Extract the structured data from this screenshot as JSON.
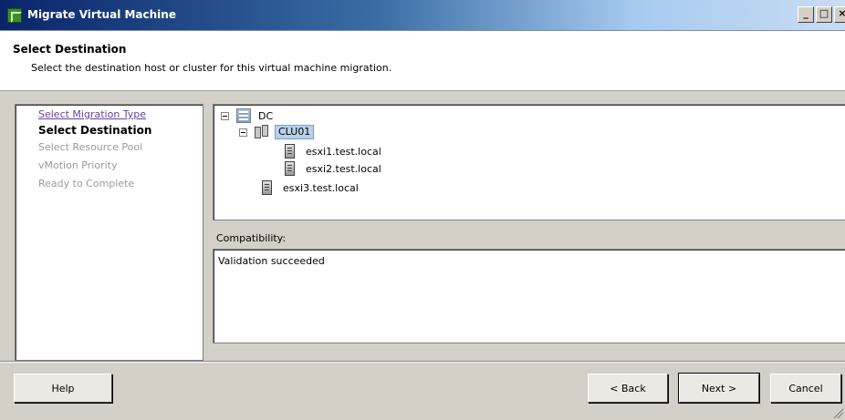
{
  "window": {
    "title": "Migrate Virtual Machine",
    "controls": [
      "_",
      "□",
      "×"
    ]
  },
  "header": {
    "title": "Select Destination",
    "subtitle": "Select the destination host or cluster for this virtual machine migration."
  },
  "steps": [
    {
      "label": "Select Migration Type",
      "state": "link"
    },
    {
      "label": "Select Destination",
      "state": "current"
    },
    {
      "label": "Select Resource Pool",
      "state": "disabled"
    },
    {
      "label": "vMotion Priority",
      "state": "disabled"
    },
    {
      "label": "Ready to Complete",
      "state": "disabled"
    }
  ],
  "tree": {
    "datacenter": {
      "label": "DC",
      "icon": "datacenter-icon"
    },
    "cluster": {
      "label": "CLU01",
      "icon": "cluster-icon",
      "selected": true
    },
    "cluster_hosts": [
      {
        "label": "esxi1.test.local",
        "icon": "server-icon"
      },
      {
        "label": "esxi2.test.local",
        "icon": "server-icon"
      }
    ],
    "standalone_host": {
      "label": "esxi3.test.local",
      "icon": "server-icon"
    }
  },
  "compatibility": {
    "label": "Compatibility:",
    "message": "Validation succeeded"
  },
  "buttons": {
    "help": "Help",
    "back": "< Back",
    "next": "Next >",
    "cancel": "Cancel"
  }
}
